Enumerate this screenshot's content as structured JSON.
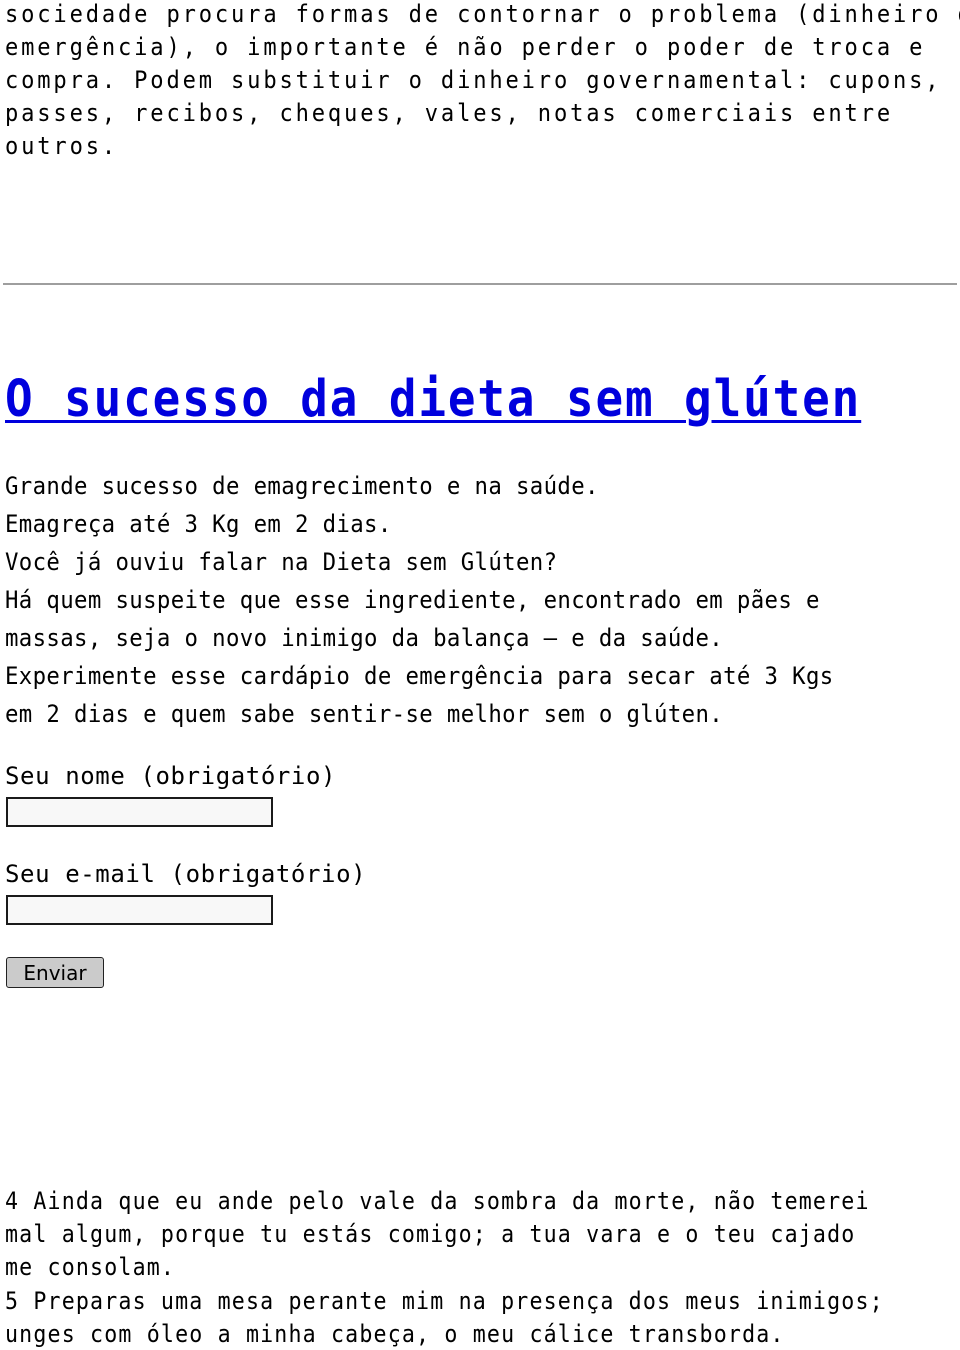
{
  "intro_paragraph": {
    "lines": [
      "sociedade procura formas de contornar o problema (dinheiro de",
      "emergência), o importante é não perder o poder de troca e",
      "compra. Podem substituir o dinheiro governamental: cupons,",
      "passes, recibos, cheques, vales, notas comerciais entre",
      "outros."
    ]
  },
  "article": {
    "title": "O sucesso da dieta sem glúten",
    "title_color": "#0000dd",
    "lines": [
      "Grande sucesso de emagrecimento e na saúde.",
      "Emagreça até 3 Kg em 2 dias.",
      "Você já ouviu falar na Dieta sem Glúten?",
      "Há quem suspeite que esse ingrediente, encontrado em pães e",
      "massas, seja o novo inimigo da balança – e da saúde.",
      "Experimente esse cardápio de emergência para secar até 3 Kgs",
      "em 2 dias e quem sabe sentir-se melhor sem o glúten."
    ]
  },
  "form": {
    "name_label": "Seu nome (obrigatório)",
    "name_value": "",
    "email_label": "Seu e-mail (obrigatório)",
    "email_value": "",
    "submit_label": "Enviar"
  },
  "psalm": {
    "lines": [
      "4 Ainda que eu ande pelo vale da sombra da morte, não temerei",
      "mal algum, porque tu estás comigo; a tua vara e o teu cajado",
      "me consolam.",
      "5 Preparas uma mesa perante mim na presença dos meus inimigos;",
      "unges com óleo a minha cabeça, o meu cálice transborda."
    ]
  }
}
